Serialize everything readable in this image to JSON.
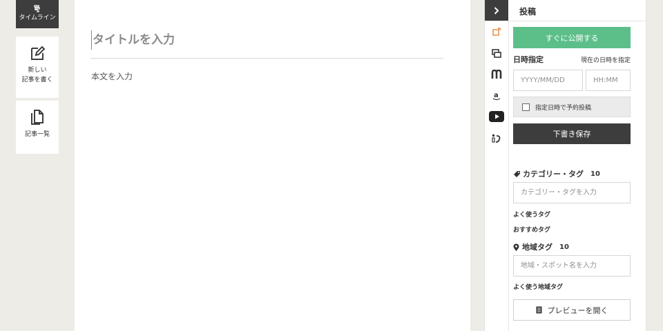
{
  "nav": {
    "timeline_label": "タイムライン",
    "new_post_label": "新しい\n記事を書く",
    "post_list_label": "記事一覧"
  },
  "editor": {
    "title_placeholder": "タイトルを入力",
    "body_placeholder": "本文を入力"
  },
  "panel": {
    "header": "投稿",
    "toggle_icon": "chevron-right-icon",
    "tools": [
      "image-icon",
      "gallery-icon",
      "m-logo-icon",
      "amazon-icon",
      "youtube-icon",
      "music-link-icon"
    ],
    "publish_now": "すぐに公開する",
    "datetime_label": "日時指定",
    "now_link": "現在の日時を指定",
    "date_placeholder": "YYYY/MM/DD",
    "time_placeholder": "HH:MM",
    "schedule_label": "指定日時で予約投稿",
    "save_draft": "下書き保存",
    "category": {
      "label": "カテゴリー・タグ",
      "count": "10",
      "placeholder": "カテゴリー・タグを入力",
      "frequent": "よく使うタグ",
      "recommended": "おすすめタグ"
    },
    "region": {
      "label": "地域タグ",
      "count": "10",
      "placeholder": "地域・スポット名を入力",
      "frequent": "よく使う地域タグ"
    },
    "preview": "プレビューを開く"
  },
  "colors": {
    "accent_green": "#5cbf8a",
    "dark": "#3d3d3d",
    "image_icon_orange": "#e8833a"
  }
}
